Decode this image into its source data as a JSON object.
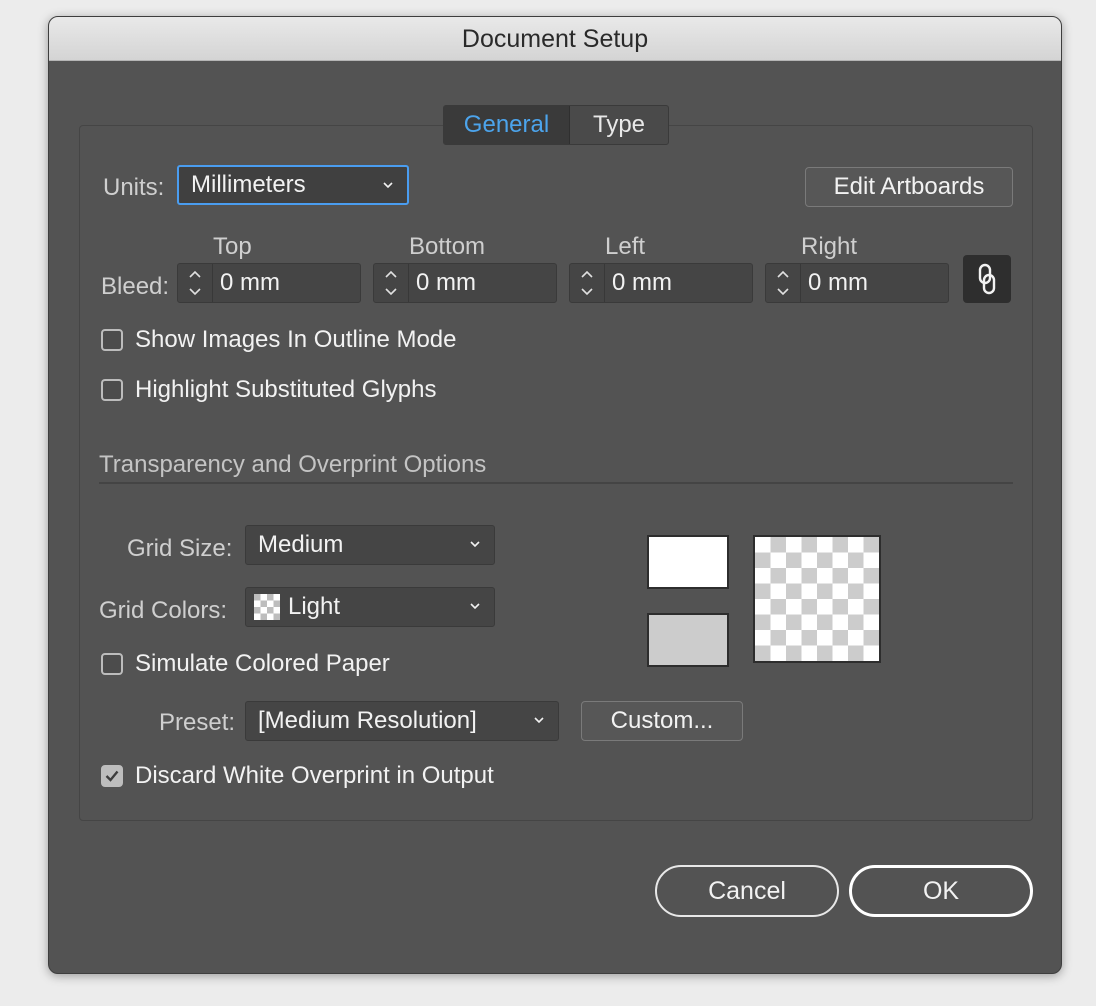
{
  "window": {
    "title": "Document Setup"
  },
  "tabs": [
    {
      "label": "General"
    },
    {
      "label": "Type"
    }
  ],
  "units": {
    "label": "Units:",
    "value": "Millimeters"
  },
  "edit_artboards": "Edit Artboards",
  "bleed": {
    "label": "Bleed:",
    "fields": [
      {
        "label": "Top",
        "value": "0 mm"
      },
      {
        "label": "Bottom",
        "value": "0 mm"
      },
      {
        "label": "Left",
        "value": "0 mm"
      },
      {
        "label": "Right",
        "value": "0 mm"
      }
    ],
    "link_icon": "link-chain-icon"
  },
  "checkboxes": {
    "outline_mode": {
      "label": "Show Images In Outline Mode",
      "checked": false
    },
    "highlight_glyphs": {
      "label": "Highlight Substituted Glyphs",
      "checked": false
    },
    "simulate_paper": {
      "label": "Simulate Colored Paper",
      "checked": false
    },
    "discard_white": {
      "label": "Discard White Overprint in Output",
      "checked": true
    }
  },
  "transparency": {
    "heading": "Transparency and Overprint Options",
    "grid_size": {
      "label": "Grid Size:",
      "value": "Medium"
    },
    "grid_colors": {
      "label": "Grid Colors:",
      "value": "Light"
    },
    "preset": {
      "label": "Preset:",
      "value": "[Medium Resolution]"
    },
    "custom_button": "Custom...",
    "swatch_colors": {
      "top": "#ffffff",
      "bottom": "#cccccc"
    }
  },
  "buttons": {
    "cancel": "Cancel",
    "ok": "OK"
  },
  "colors": {
    "accent": "#4ca4ec",
    "dialog_bg": "#535353"
  }
}
